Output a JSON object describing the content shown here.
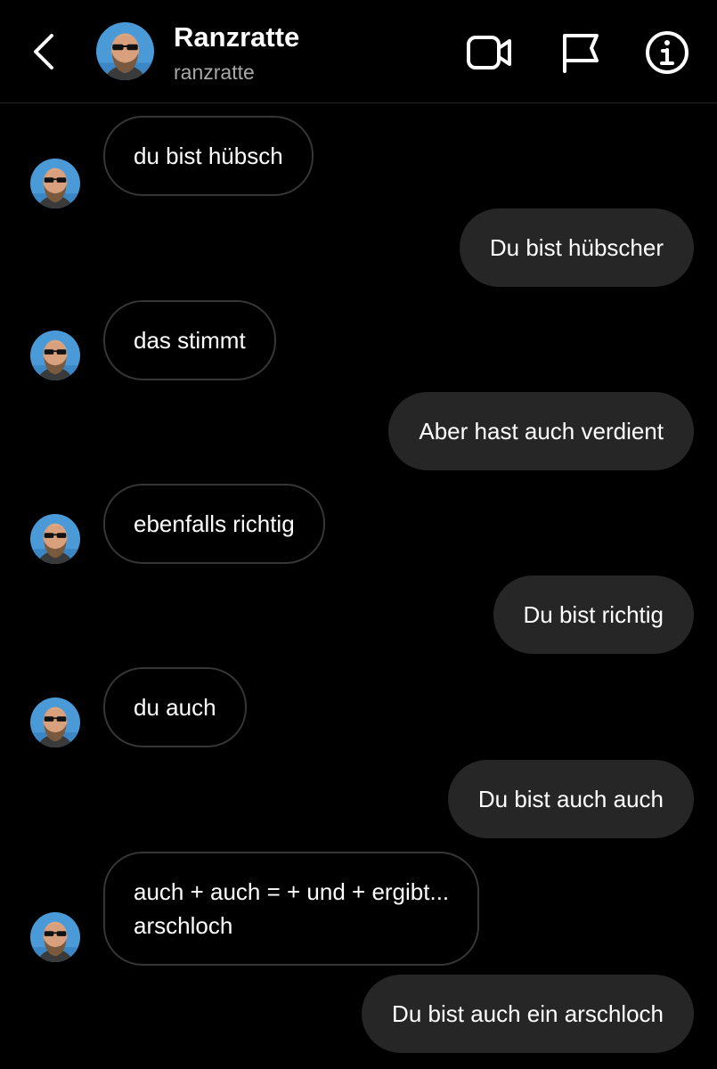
{
  "header": {
    "name": "Ranzratte",
    "username": "ranzratte",
    "icons": [
      "back-chevron-icon",
      "video-camera-icon",
      "flag-icon",
      "info-icon"
    ]
  },
  "colors": {
    "background": "#000000",
    "outgoing_bubble": "#262626",
    "incoming_border": "#363636",
    "secondary_text": "#a8a8a8",
    "avatar_sky": "#4a9ad8"
  },
  "messages": [
    {
      "direction": "incoming",
      "text": "du bist hübsch"
    },
    {
      "direction": "outgoing",
      "text": "Du bist hübscher"
    },
    {
      "direction": "incoming",
      "text": "das stimmt"
    },
    {
      "direction": "outgoing",
      "text": "Aber hast auch verdient"
    },
    {
      "direction": "incoming",
      "text": "ebenfalls richtig"
    },
    {
      "direction": "outgoing",
      "text": "Du bist richtig"
    },
    {
      "direction": "incoming",
      "text": "du auch"
    },
    {
      "direction": "outgoing",
      "text": "Du bist auch auch"
    },
    {
      "direction": "incoming",
      "text": "auch + auch = + und + ergibt...\narschloch"
    },
    {
      "direction": "outgoing",
      "text": "Du bist auch ein arschloch"
    }
  ]
}
